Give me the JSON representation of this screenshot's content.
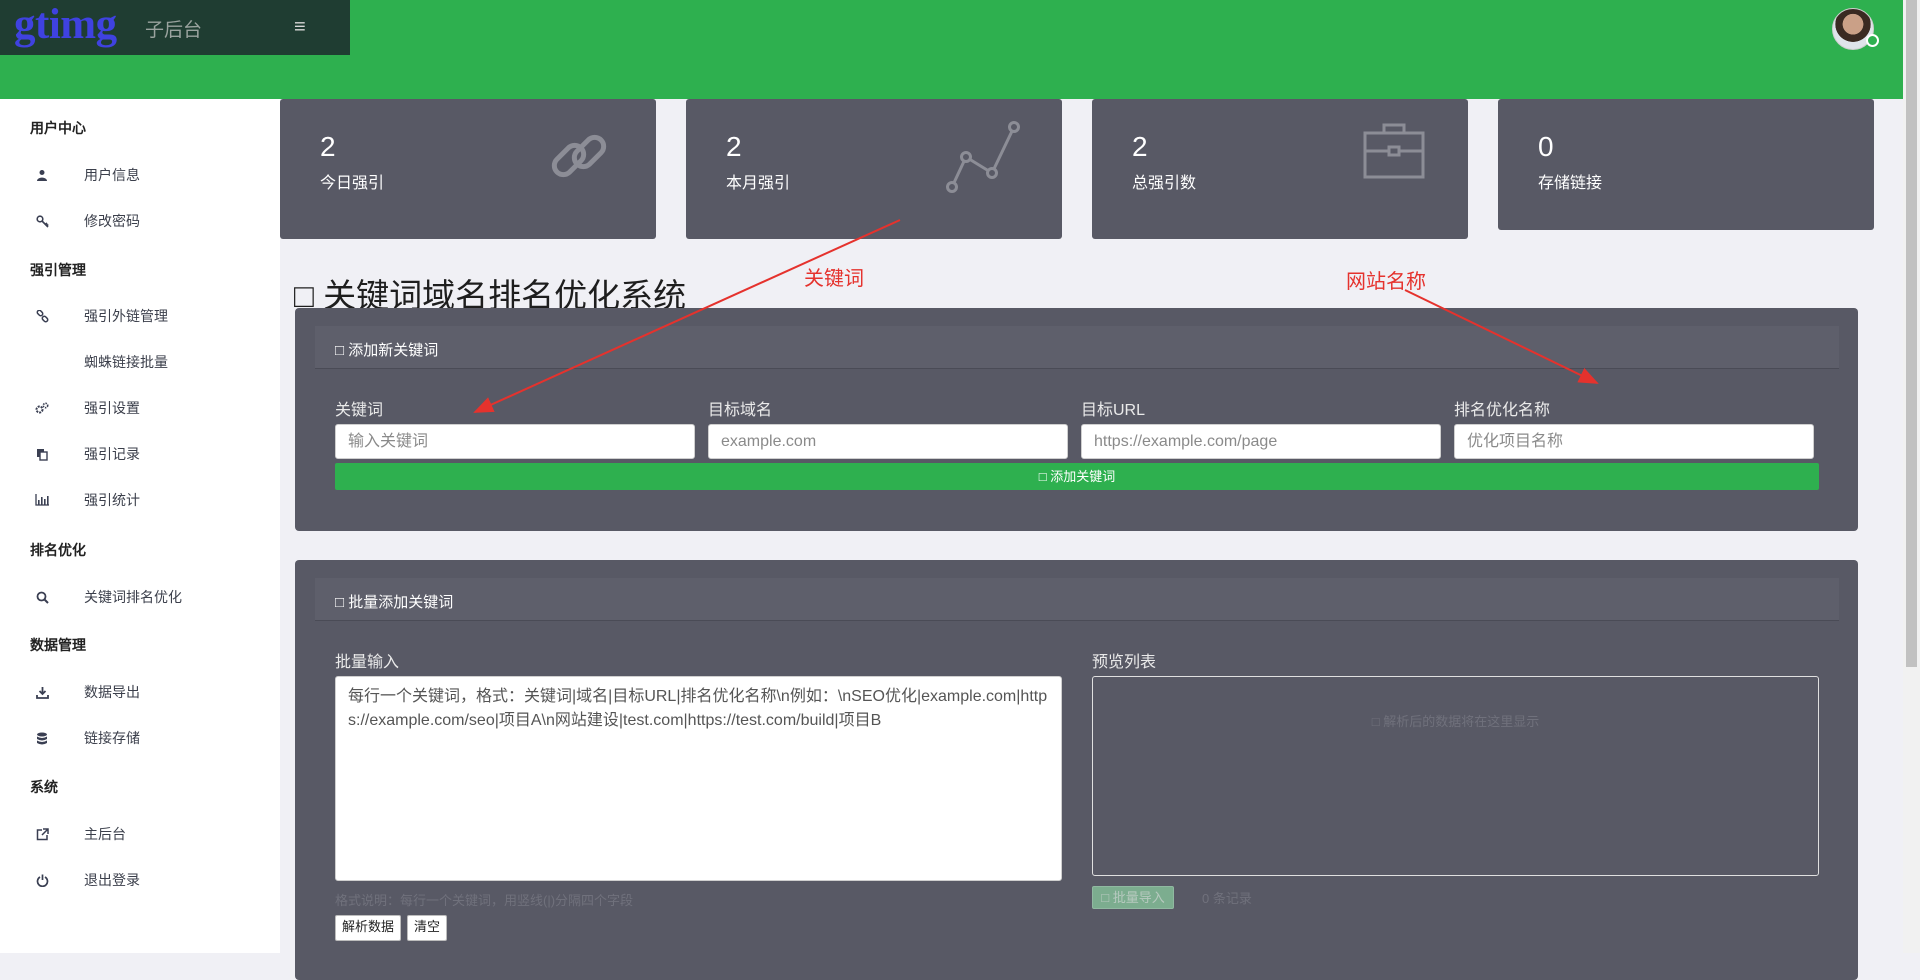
{
  "header": {
    "logo_text": "gtimg",
    "subtitle": "子后台",
    "menu_icon": "hamburger-icon",
    "avatar_icon": "user-avatar"
  },
  "sidebar": {
    "groups": [
      {
        "title": "用户中心",
        "items": [
          {
            "label": "用户信息",
            "icon": "user-icon"
          },
          {
            "label": "修改密码",
            "icon": "key-icon"
          }
        ]
      },
      {
        "title": "强引管理",
        "items": [
          {
            "label": "强引外链管理",
            "icon": "link-icon"
          },
          {
            "label": "蜘蛛链接批量",
            "icon": ""
          },
          {
            "label": "强引设置",
            "icon": "gears-icon"
          },
          {
            "label": "强引记录",
            "icon": "copy-icon"
          },
          {
            "label": "强引统计",
            "icon": "bar-chart-icon"
          }
        ]
      },
      {
        "title": "排名优化",
        "items": [
          {
            "label": "关键词排名优化",
            "icon": "search-icon"
          }
        ]
      },
      {
        "title": "数据管理",
        "items": [
          {
            "label": "数据导出",
            "icon": "download-icon"
          },
          {
            "label": "链接存储",
            "icon": "database-icon"
          }
        ]
      },
      {
        "title": "系统",
        "items": [
          {
            "label": "主后台",
            "icon": "external-link-icon"
          },
          {
            "label": "退出登录",
            "icon": "power-icon"
          }
        ]
      }
    ]
  },
  "stats": [
    {
      "value": "2",
      "label": "今日强引",
      "icon": "chain-link-icon"
    },
    {
      "value": "2",
      "label": "本月强引",
      "icon": "line-chart-icon"
    },
    {
      "value": "2",
      "label": "总强引数",
      "icon": "briefcase-icon"
    },
    {
      "value": "0",
      "label": "存储链接",
      "icon": ""
    }
  ],
  "page_title": "□ 关键词域名排名优化系统",
  "add_panel": {
    "heading": "□ 添加新关键词",
    "fields": [
      {
        "label": "关键词",
        "placeholder": "输入关键词"
      },
      {
        "label": "目标域名",
        "placeholder": "example.com"
      },
      {
        "label": "目标URL",
        "placeholder": "https://example.com/page"
      },
      {
        "label": "排名优化名称",
        "placeholder": "优化项目名称"
      }
    ],
    "submit_label": "□ 添加关键词"
  },
  "batch_panel": {
    "heading": "□ 批量添加关键词",
    "input_label": "批量输入",
    "textarea_placeholder": "每行一个关键词，格式：关键词|域名|目标URL|排名优化名称\\n例如：\\nSEO优化|example.com|https://example.com/seo|项目A\\n网站建设|test.com|https://test.com/build|项目B",
    "hint": "格式说明：每行一个关键词，用竖线(|)分隔四个字段",
    "parse_button": "解析数据",
    "clear_button": "清空",
    "preview_label": "预览列表",
    "preview_empty": "□ 解析后的数据将在这里显示",
    "import_button": "□ 批量导入",
    "record_count": "0 条记录"
  },
  "annotations": {
    "keyword": "关键词",
    "site_name": "网站名称"
  },
  "colors": {
    "header_green": "#2eb04f",
    "card_bg": "#585965",
    "annotation_red": "#e5322d"
  }
}
